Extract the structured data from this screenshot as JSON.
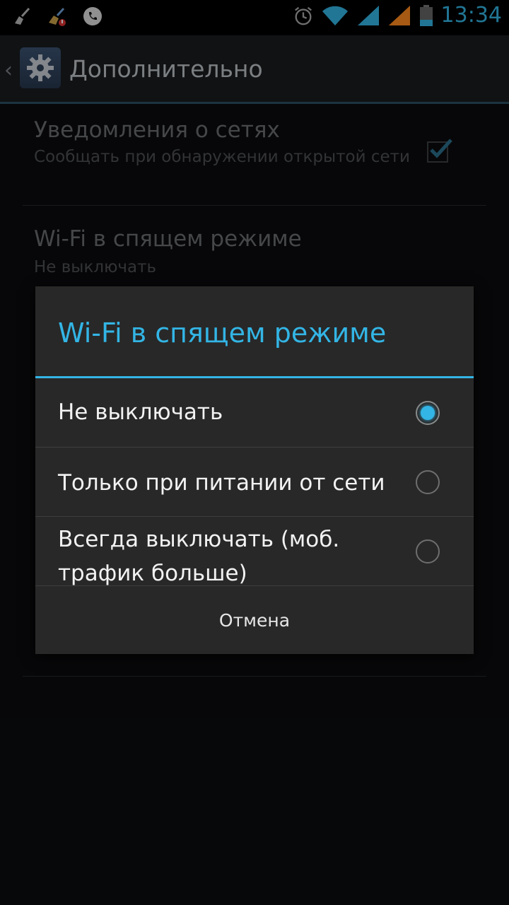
{
  "status_bar": {
    "time": "13:34",
    "icons": [
      "broom-icon",
      "app-update-icon",
      "phone-icon",
      "alarm-icon",
      "wifi-icon",
      "signal-icon",
      "signal-icon",
      "battery-icon"
    ]
  },
  "action_bar": {
    "title": "Дополнительно",
    "app_icon": "gear-icon"
  },
  "background_list": {
    "items": [
      {
        "title": "Уведомления о сетях",
        "summary": "Сообщать при обнаружении открытой сети",
        "checked": true
      },
      {
        "title": "Wi-Fi в спящем режиме",
        "summary": "Не выключать"
      }
    ]
  },
  "dialog": {
    "title": "Wi-Fi в спящем режиме",
    "options": [
      {
        "label": "Не выключать",
        "selected": true
      },
      {
        "label": "Только при питании от сети",
        "selected": false
      },
      {
        "label": "Всегда выключать (моб. трафик больше)",
        "selected": false
      }
    ],
    "cancel_label": "Отмена"
  },
  "colors": {
    "accent": "#33b5e5",
    "dialog_bg": "#282828"
  }
}
